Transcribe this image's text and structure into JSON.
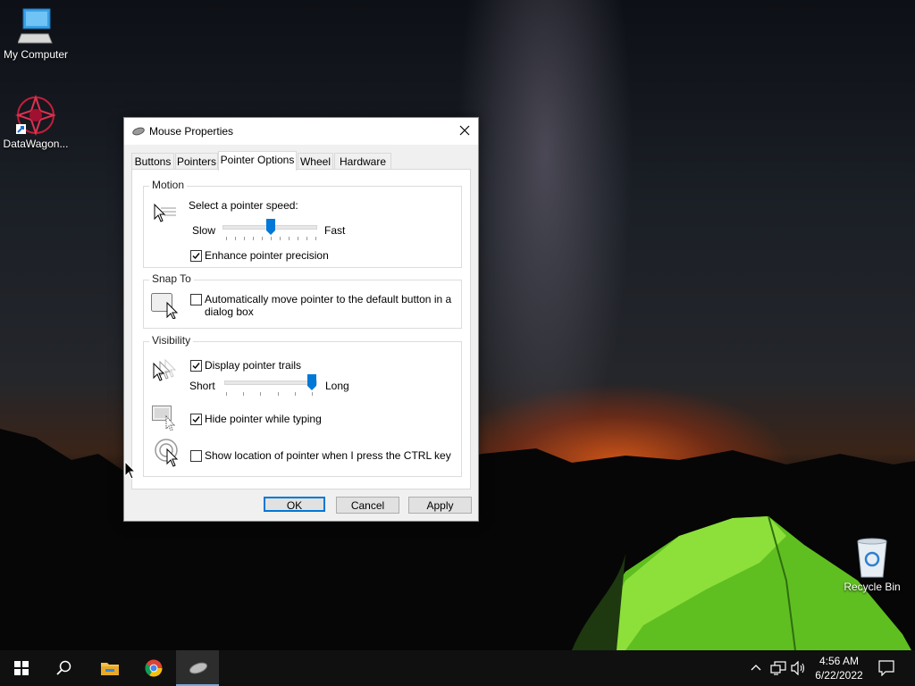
{
  "desktop": {
    "icons": [
      {
        "label": "My Computer"
      },
      {
        "label": "DataWagon..."
      },
      {
        "label": "Recycle Bin"
      }
    ]
  },
  "dialog": {
    "title": "Mouse Properties",
    "tabs": [
      {
        "label": "Buttons"
      },
      {
        "label": "Pointers"
      },
      {
        "label": "Pointer Options",
        "active": true
      },
      {
        "label": "Wheel"
      },
      {
        "label": "Hardware"
      }
    ],
    "motion": {
      "legend": "Motion",
      "speed_label": "Select a pointer speed:",
      "slow_label": "Slow",
      "fast_label": "Fast",
      "speed_value": 0.5,
      "enhance_label": "Enhance pointer precision",
      "enhance_checked": true
    },
    "snap_to": {
      "legend": "Snap To",
      "auto_move_label_line1": "Automatically move pointer to the default button in a",
      "auto_move_label_line2": "dialog box",
      "auto_move_checked": false
    },
    "visibility": {
      "legend": "Visibility",
      "trails_label": "Display pointer trails",
      "trails_checked": true,
      "short_label": "Short",
      "long_label": "Long",
      "trails_length_value": 1.0,
      "hide_typing_label": "Hide pointer while typing",
      "hide_typing_checked": true,
      "show_location_label": "Show location of pointer when I press the CTRL key",
      "show_location_checked": false
    },
    "buttons": {
      "ok": "OK",
      "cancel": "Cancel",
      "apply": "Apply"
    }
  },
  "taskbar": {
    "time": "4:56 AM",
    "date": "6/22/2022"
  },
  "colors": {
    "accent": "#0078d7",
    "taskbar": "#101010"
  }
}
